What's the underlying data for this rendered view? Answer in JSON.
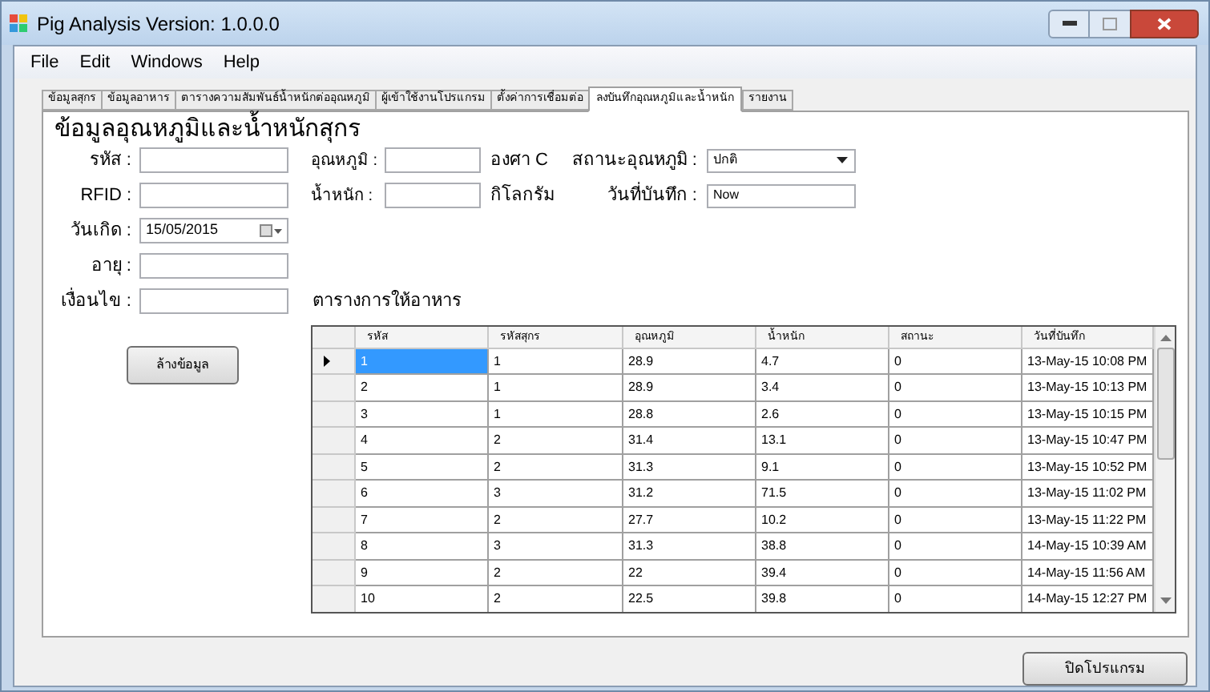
{
  "window": {
    "title": "Pig Analysis Version: 1.0.0.0"
  },
  "menu": [
    "File",
    "Edit",
    "Windows",
    "Help"
  ],
  "tabs": [
    {
      "label": "ข้อมูลสุกร",
      "selected": false
    },
    {
      "label": "ข้อมูลอาหาร",
      "selected": false
    },
    {
      "label": "ตารางความสัมพันธ์น้ำหนักต่ออุณหภูมิ",
      "selected": false
    },
    {
      "label": "ผู้เข้าใช้งานโปรแกรม",
      "selected": false
    },
    {
      "label": "ตั้งค่าการเชื่อมต่อ",
      "selected": false
    },
    {
      "label": "ลงบันทึกอุณหภูมิและน้ำหนัก",
      "selected": true
    },
    {
      "label": "รายงาน",
      "selected": false
    }
  ],
  "heading": "ข้อมูลอุณหภูมิและน้ำหนักสุกร",
  "left_fields": [
    {
      "label": "รหัส :"
    },
    {
      "label": "RFID :"
    },
    {
      "label": "วันเกิด :",
      "value": "15/05/2015",
      "kind": "date"
    },
    {
      "label": "อายุ :"
    },
    {
      "label": "เงื่อนไข :"
    }
  ],
  "middle_fields": [
    {
      "label": "อุณหภูมิ :",
      "unit": "องศา C"
    },
    {
      "label": "น้ำหนัก :",
      "unit": "กิโลกรัม"
    }
  ],
  "right_fields": [
    {
      "label": "สถานะอุณหภูมิ :",
      "value": "ปกติ",
      "kind": "dropdown"
    },
    {
      "label": "วันที่บันทึก :",
      "value": "Now",
      "kind": "text"
    }
  ],
  "clear_button": "ล้างข้อมูล",
  "table": {
    "title": "ตารางการให้อาหาร",
    "columns": [
      "รหัส",
      "รหัสสุกร",
      "อุณหภูมิ",
      "น้ำหนัก",
      "สถานะ",
      "วันที่บันทึก"
    ],
    "rows": [
      {
        "cells": [
          "1",
          "1",
          "28.9",
          "4.7",
          "0",
          "13-May-15 10:08 PM"
        ],
        "selected": true
      },
      {
        "cells": [
          "2",
          "1",
          "28.9",
          "3.4",
          "0",
          "13-May-15 10:13 PM"
        ],
        "selected": false
      },
      {
        "cells": [
          "3",
          "1",
          "28.8",
          "2.6",
          "0",
          "13-May-15 10:15 PM"
        ],
        "selected": false
      },
      {
        "cells": [
          "4",
          "2",
          "31.4",
          "13.1",
          "0",
          "13-May-15 10:47 PM"
        ],
        "selected": false
      },
      {
        "cells": [
          "5",
          "2",
          "31.3",
          "9.1",
          "0",
          "13-May-15 10:52 PM"
        ],
        "selected": false
      },
      {
        "cells": [
          "6",
          "3",
          "31.2",
          "71.5",
          "0",
          "13-May-15 11:02 PM"
        ],
        "selected": false
      },
      {
        "cells": [
          "7",
          "2",
          "27.7",
          "10.2",
          "0",
          "13-May-15 11:22 PM"
        ],
        "selected": false
      },
      {
        "cells": [
          "8",
          "3",
          "31.3",
          "38.8",
          "0",
          "14-May-15 10:39 AM"
        ],
        "selected": false
      },
      {
        "cells": [
          "9",
          "2",
          "22",
          "39.4",
          "0",
          "14-May-15 11:56 AM"
        ],
        "selected": false
      },
      {
        "cells": [
          "10",
          "2",
          "22.5",
          "39.8",
          "0",
          "14-May-15 12:27 PM"
        ],
        "selected": false
      }
    ]
  },
  "close_button": "ปิดโปรแกรม"
}
